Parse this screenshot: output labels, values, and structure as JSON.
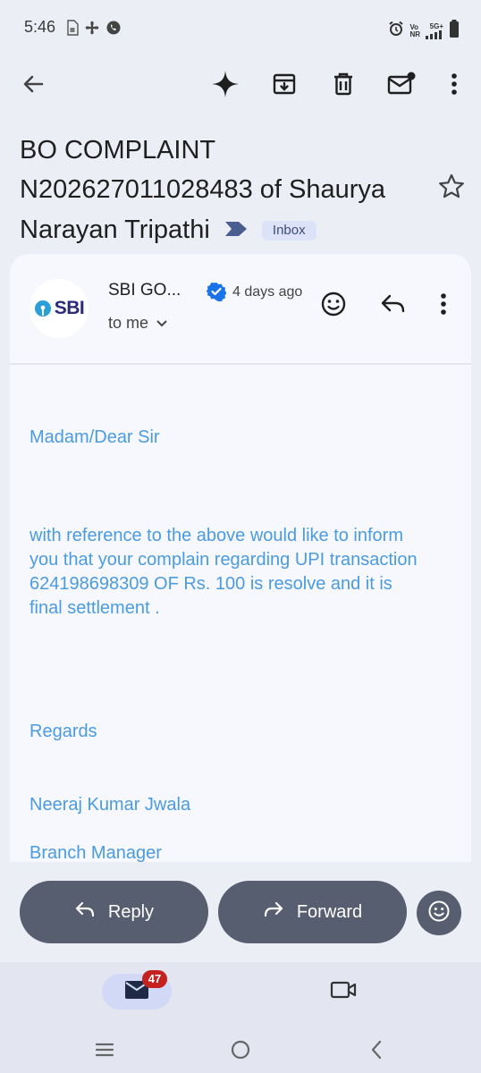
{
  "status_bar": {
    "time": "5:46",
    "icons": [
      "sim-icon",
      "pinwheel-icon",
      "whatsapp-icon",
      "alarm-icon",
      "vonr-icon",
      "5g-signal-icon",
      "battery-icon"
    ],
    "vo_label": "Vo",
    "nr_label": "NR",
    "network": "5G+"
  },
  "app_bar": {
    "icons": [
      "back-arrow-icon",
      "sparkle-icon",
      "archive-icon",
      "delete-icon",
      "mark-unread-icon",
      "more-vert-icon"
    ]
  },
  "email": {
    "subject": "BO COMPLAINT N202627011028483 of Shaurya Narayan Tripathi",
    "label": "Inbox",
    "sender": "SBI GO...",
    "time_ago": "4 days ago",
    "to": "to me",
    "avatar_text": "SBI",
    "body": {
      "greeting": "Madam/Dear Sir",
      "paragraph": "with reference to the above would like to inform you that your complain regarding   UPI transaction 624198698309 OF Rs. 100 is resolve and it is final settlement .",
      "regards": "Regards",
      "signer_name": "Neeraj Kumar Jwala",
      "signer_title": "Branch Manager"
    }
  },
  "actions": {
    "reply_label": "Reply",
    "forward_label": "Forward"
  },
  "bottom_nav": {
    "mail_badge": "47"
  },
  "colors": {
    "body_text": "#4a9be0",
    "action_button": "#575e6f",
    "chip_bg": "#dce3f9",
    "badge": "#c5221f",
    "accent_verified": "#1a73e8"
  }
}
